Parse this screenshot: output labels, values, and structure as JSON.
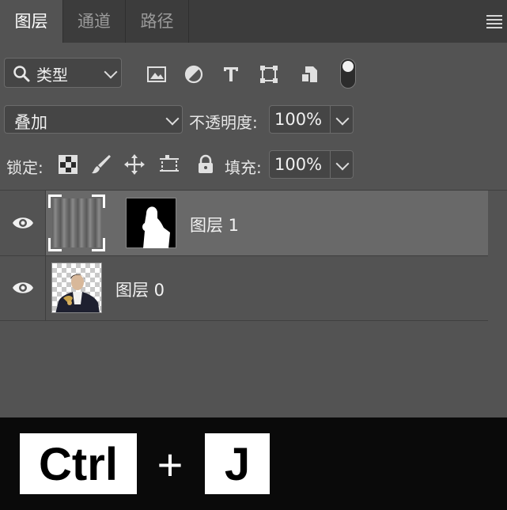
{
  "tabs": [
    {
      "label": "图层",
      "active": true
    },
    {
      "label": "通道",
      "active": false
    },
    {
      "label": "路径",
      "active": false
    }
  ],
  "filter": {
    "kind_label": "类型",
    "icons": [
      "image-filter-icon",
      "adjustment-filter-icon",
      "type-filter-icon",
      "shape-filter-icon",
      "smart-object-filter-icon",
      "filter-toggle-icon"
    ]
  },
  "blend": {
    "mode": "叠加",
    "opacity_label": "不透明度:",
    "opacity_value": "100%"
  },
  "lock": {
    "label": "锁定:",
    "fill_label": "填充:",
    "fill_value": "100%",
    "icons": [
      "lock-transparent-pixels-icon",
      "lock-image-pixels-icon",
      "lock-position-icon",
      "prevent-auto-nesting-icon",
      "lock-all-icon"
    ]
  },
  "layers": [
    {
      "name": "图层 1",
      "visible": true,
      "selected": true,
      "has_mask": true
    },
    {
      "name": "图层 0",
      "visible": true,
      "selected": false,
      "has_mask": false
    }
  ],
  "shortcut": {
    "key1": "Ctrl",
    "plus": "+",
    "key2": "J"
  },
  "colors": {
    "panel": "#535353",
    "tabbar": "#3c3c3c",
    "selected_row": "#696969",
    "shortcut_bg": "#0a0a0a"
  }
}
